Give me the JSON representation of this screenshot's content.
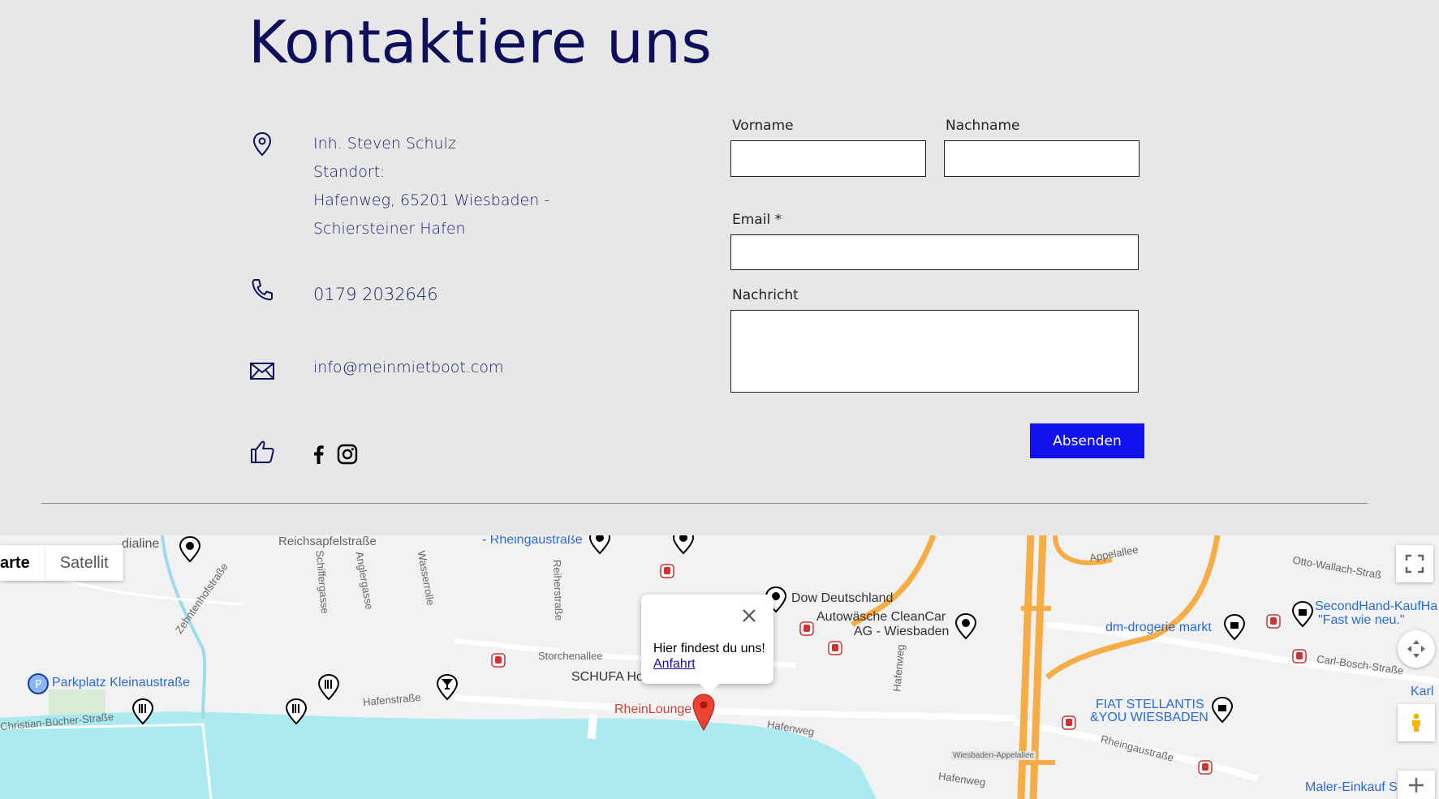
{
  "contact": {
    "title": "Kontaktiere uns",
    "address_lines": [
      "Inh. Steven Schulz",
      "Standort:",
      "Hafenweg, 65201 Wiesbaden -",
      "Schiersteiner Hafen"
    ],
    "phone": "0179 2032646",
    "email": "info@meinmietboot.com"
  },
  "form": {
    "firstname_label": "Vorname",
    "lastname_label": "Nachname",
    "email_label": "Email *",
    "message_label": "Nachricht",
    "firstname_value": "",
    "lastname_value": "",
    "email_value": "",
    "message_value": "",
    "submit_label": "Absenden"
  },
  "map": {
    "type_selected": "arte",
    "type_other": "Satellit",
    "popup_text": "Hier findest du uns!",
    "popup_link": "Anfahrt",
    "places": {
      "dialine": "dialine",
      "reichsapfel": "Reichsapfelstraße",
      "rheingau_top": "- Rheingaustraße",
      "appelallee": "Appelallee",
      "otto_wallach": "Otto-Wallach-Straß",
      "dow": "Dow Deutschland",
      "cleancar1": "Autowäsche CleanCar",
      "cleancar2": "AG - Wiesbaden",
      "dm": "dm-drogerie markt",
      "secondhand1": "SecondHand-KaufHa",
      "secondhand2": "\"Fast wie neu.\"",
      "carl_bosch": "Carl-Bosch-Straße",
      "parkplatz": "Parkplatz Kleinaustraße",
      "storchen": "Storchenallee",
      "schufa": "SCHUFA Ho",
      "rheinlounge": "RheinLounge",
      "fiat1": "FIAT STELLANTIS",
      "fiat2": "&YOU WIESBADEN",
      "rheingau_bottom": "Rheingaustraße",
      "christian": "Christian-Bücher-Straße",
      "hafenstr": "Hafenstraße",
      "hafenweg1": "Hafenweg",
      "hafenweg2": "Hafenweg",
      "hafenweg3": "Hafenweg",
      "zehnten": "Zehntenhofstraße",
      "schiffer": "Schiffergasse",
      "angler": "Anglergasse",
      "wasser": "Wasserrolle",
      "reiher": "Reiherstraße",
      "karl": "Karl",
      "maler": "Maler-Einkauf S",
      "appelallee_station": "Wiesbaden-Appelallee"
    }
  },
  "colors": {
    "navy": "#0d0f5c",
    "button": "#1212f0",
    "water": "#aaeaf0",
    "highway": "#f6ad45"
  }
}
